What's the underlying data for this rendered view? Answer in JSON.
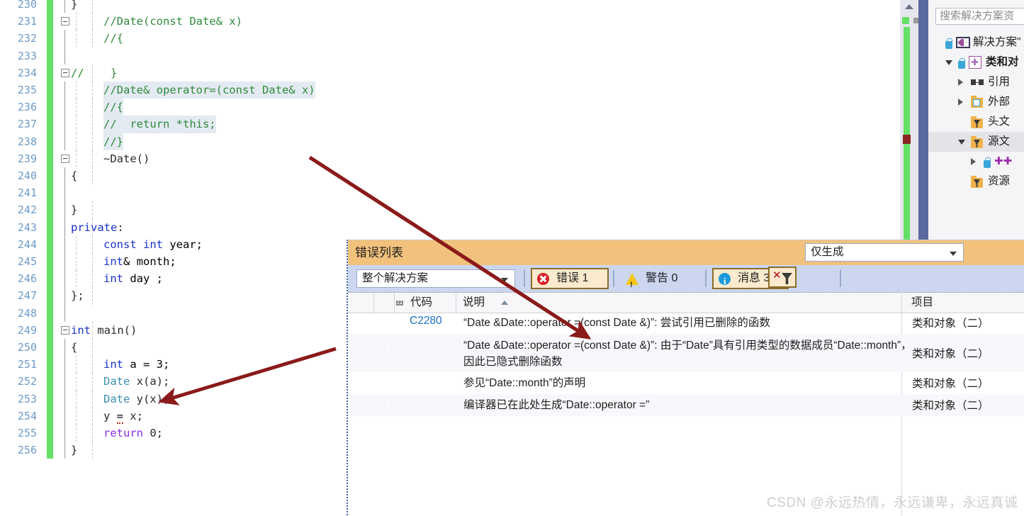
{
  "editor": {
    "first_line_number": 230,
    "lines": [
      {
        "n": 230,
        "indent": 0,
        "text": "}",
        "kind": "plain",
        "fold": false,
        "sel": false
      },
      {
        "n": 231,
        "indent": 0,
        "text": "//Date(const Date& x)",
        "kind": "comment",
        "fold": true,
        "sel": false
      },
      {
        "n": 232,
        "indent": 0,
        "text": "//{",
        "kind": "comment",
        "fold": false,
        "sel": false
      },
      {
        "n": 233,
        "indent": 0,
        "text": "",
        "kind": "plain",
        "fold": false,
        "sel": false
      },
      {
        "n": 234,
        "indent": 0,
        "text": "//    }",
        "kind": "comment",
        "fold": true,
        "sel": false
      },
      {
        "n": 235,
        "indent": 0,
        "text": "//Date& operator=(const Date& x)",
        "kind": "comment",
        "fold": false,
        "sel": true
      },
      {
        "n": 236,
        "indent": 0,
        "text": "//{",
        "kind": "comment",
        "fold": false,
        "sel": true
      },
      {
        "n": 237,
        "indent": 0,
        "text": "//  return *this;",
        "kind": "comment",
        "fold": false,
        "sel": true
      },
      {
        "n": 238,
        "indent": 0,
        "text": "//}",
        "kind": "comment",
        "fold": false,
        "sel": true
      },
      {
        "n": 239,
        "indent": 0,
        "text": "~Date()",
        "kind": "plain",
        "fold": true,
        "sel": false
      },
      {
        "n": 240,
        "indent": 0,
        "text": "{",
        "kind": "plain",
        "fold": false,
        "sel": false
      },
      {
        "n": 241,
        "indent": 0,
        "text": "",
        "kind": "plain",
        "fold": false,
        "sel": false
      },
      {
        "n": 242,
        "indent": 0,
        "text": "}",
        "kind": "plain",
        "fold": false,
        "sel": false
      },
      {
        "n": 243,
        "indent": 0,
        "text": "private:",
        "kind": "keyword",
        "fold": false,
        "sel": false
      },
      {
        "n": 244,
        "indent": 0,
        "text": "const int year;",
        "kind": "decl",
        "fold": false,
        "sel": false
      },
      {
        "n": 245,
        "indent": 0,
        "text": "int& month;",
        "kind": "decl",
        "fold": false,
        "sel": false
      },
      {
        "n": 246,
        "indent": 0,
        "text": "int day ;",
        "kind": "decl",
        "fold": false,
        "sel": false
      },
      {
        "n": 247,
        "indent": 0,
        "text": "};",
        "kind": "plain",
        "fold": false,
        "sel": false
      },
      {
        "n": 248,
        "indent": 0,
        "text": "",
        "kind": "plain",
        "fold": false,
        "sel": false
      },
      {
        "n": 249,
        "indent": 0,
        "text": "int main()",
        "kind": "main",
        "fold": true,
        "sel": false
      },
      {
        "n": 250,
        "indent": 0,
        "text": "{",
        "kind": "plain",
        "fold": false,
        "sel": false
      },
      {
        "n": 251,
        "indent": 0,
        "text": "int a = 3;",
        "kind": "decl",
        "fold": false,
        "sel": false
      },
      {
        "n": 252,
        "indent": 0,
        "text": "Date x(a);",
        "kind": "type",
        "fold": false,
        "sel": false
      },
      {
        "n": 253,
        "indent": 0,
        "text": "Date y(x);",
        "kind": "type",
        "fold": false,
        "sel": false
      },
      {
        "n": 254,
        "indent": 0,
        "text": "y = x;",
        "kind": "error",
        "fold": false,
        "sel": false
      },
      {
        "n": 255,
        "indent": 0,
        "text": "return 0;",
        "kind": "return",
        "fold": false,
        "sel": false
      },
      {
        "n": 256,
        "indent": 0,
        "text": "}",
        "kind": "plain",
        "fold": false,
        "sel": false
      }
    ]
  },
  "solution_explorer": {
    "search_placeholder": "搜索解决方案资",
    "items": [
      {
        "label": "解决方案\"",
        "icon": "visual-studio-solution-icon",
        "depth": 0,
        "twisty": "none",
        "lock": true,
        "bold": false
      },
      {
        "label": "类和对",
        "icon": "cpp-project-icon",
        "depth": 1,
        "twisty": "open",
        "lock": true,
        "bold": true
      },
      {
        "label": "引用",
        "icon": "references-icon",
        "depth": 2,
        "twisty": "closed",
        "lock": false,
        "bold": false
      },
      {
        "label": "外部",
        "icon": "external-dependencies-folder-icon",
        "depth": 2,
        "twisty": "closed",
        "lock": false,
        "bold": false
      },
      {
        "label": "头文",
        "icon": "header-files-folder-icon",
        "depth": 2,
        "twisty": "none",
        "lock": false,
        "bold": false
      },
      {
        "label": "源文",
        "icon": "source-files-folder-icon",
        "depth": 2,
        "twisty": "open",
        "lock": false,
        "bold": false,
        "selected": true
      },
      {
        "label": "",
        "icon": "cpp-file-icon",
        "depth": 3,
        "twisty": "closed",
        "lock": true,
        "bold": false
      },
      {
        "label": "资源",
        "icon": "resource-files-folder-icon",
        "depth": 2,
        "twisty": "none",
        "lock": false,
        "bold": false
      }
    ]
  },
  "error_list": {
    "title": "错误列表",
    "scope_filter": "整个解决方案",
    "build_filter": "仅生成",
    "toolbar": {
      "errors_label": "错误 1",
      "warnings_label": "警告 0",
      "messages_label": "消息 3",
      "clear_filter_label": "clear-filter"
    },
    "columns": [
      "",
      "",
      "代码",
      "说明",
      "项目"
    ],
    "sorted_column": "说明",
    "sort_direction": "asc",
    "rows": [
      {
        "severity": "error",
        "code": "C2280",
        "description": "“Date &Date::operator =(const Date &)”: 尝试引用已删除的函数",
        "project": "类和对象（二）"
      },
      {
        "severity": "info",
        "code": "",
        "description": "“Date &Date::operator =(const Date &)”: 由于“Date”具有引用类型的数据成员“Date::month”，因此已隐式删除函数",
        "project": "类和对象（二）"
      },
      {
        "severity": "info",
        "code": "",
        "description": "参见“Date::month”的声明",
        "project": "类和对象（二）"
      },
      {
        "severity": "info",
        "code": "",
        "description": "编译器已在此处生成“Date::operator =”",
        "project": "类和对象（二）"
      }
    ]
  },
  "annotations": {
    "arrow_color": "#8b1a1a",
    "arrow_1_target": "error-list-first-row",
    "arrow_2_target": "code-line-254"
  },
  "watermark": {
    "text": "CSDN @永远热情，永远谦卑，永远真诚"
  }
}
